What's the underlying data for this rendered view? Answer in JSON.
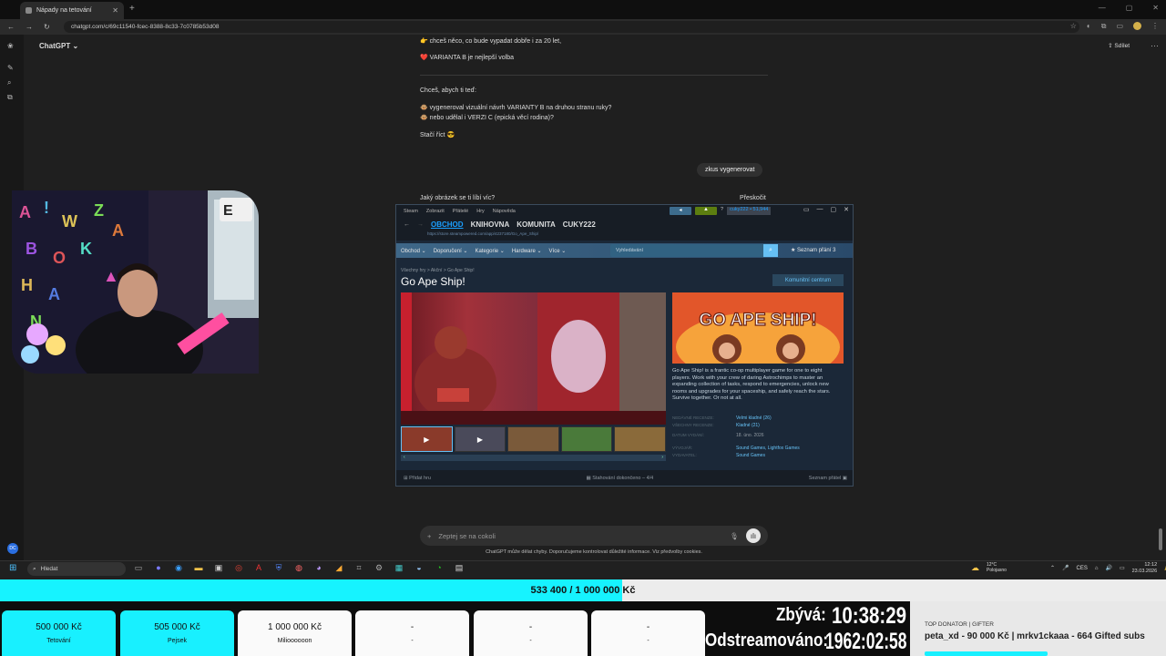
{
  "browser": {
    "tab_title": "Nápady na tetování",
    "url": "chatgpt.com/c/69c11540-fcec-8388-8c33-7c0785b53d08"
  },
  "chatgpt": {
    "app_name": "ChatGPT",
    "share_label": "Sdílet",
    "lines": [
      {
        "icon": "👉",
        "text": "chceš něco, co bude vypadat dobře i za 20 let,"
      },
      {
        "icon": "❤️",
        "text": "VARIANTA B je nejlepší volba"
      }
    ],
    "offer_intro": "Chceš, abych ti teď:",
    "offer_items": [
      {
        "icon": "🐵",
        "text": "vygeneroval vizuální návrh VARIANTY B na druhou stranu ruky?"
      },
      {
        "icon": "🐵",
        "text": "nebo udělal i VERZI C (epická věcí rodina)?"
      }
    ],
    "outro": "Stačí říct 😎",
    "user_message": "zkus vygenerovat",
    "question": "Jaký obrázek se ti líbí víc?",
    "skip": "Přeskočit",
    "prompt_placeholder": "Zeptej se na cokoli",
    "disclaimer": "ChatGPT může dělat chyby. Doporučujeme kontrolovat důležité informace. Viz předvolby cookies."
  },
  "steam": {
    "topmenu": [
      "Steam",
      "Zobrazit",
      "Přátelé",
      "Hry",
      "Nápověda"
    ],
    "username": "cuky222 • 51,944",
    "nav": [
      "OBCHOD",
      "KNIHOVNA",
      "KOMUNITA",
      "CUKY222"
    ],
    "store_url": "https://store.steampowered.com/app/4237180/Go_Ape_Ship/",
    "menu": [
      "Obchod ⌄",
      "Doporučení ⌄",
      "Kategorie ⌄",
      "Hardware ⌄",
      "Více ⌄"
    ],
    "search_placeholder": "Vyhledávání",
    "wishlist": "★ Seznam přání 3",
    "breadcrumb": "Všechny hry > Akční > Go Ape Ship!",
    "game_title": "Go Ape Ship!",
    "community_hub": "Komunitní centrum",
    "capsule_title": "GO APE SHIP!",
    "description": "Go Ape Ship! is a frantic co-op multiplayer game for one to eight players. Work with your crew of daring Astrochimps to master an expanding collection of tasks, respond to emergencies, unlock new rooms and upgrades for your spaceship, and safely reach the stars. Survive together. Or not at all.",
    "info": [
      {
        "k": "Nedávné recenze:",
        "v": "Velmi kladné (26)"
      },
      {
        "k": "Všechny recenze:",
        "v": "Kladné (21)"
      },
      {
        "k": "Datum vydání:",
        "v": "18. úno. 2026"
      },
      {
        "k": "Vývojář:",
        "v": "Sound Games, Lightfox Games"
      },
      {
        "k": "Vydavatel:",
        "v": "Sound Games"
      }
    ],
    "bottom_left": "Přidat hru",
    "bottom_mid": "Stahování dokončeno – 4/4",
    "bottom_right": "Seznam přátel"
  },
  "taskbar": {
    "search": "Hledat",
    "weather_temp": "12°C",
    "weather_desc": "Polojasno",
    "lang": "CES",
    "time": "12:12",
    "date": "23.03.2026"
  },
  "stream": {
    "goal_text": "533 400 / 1 000 000 Kč",
    "goal_progress": 0.5334,
    "cards": [
      {
        "amount": "500 000 Kč",
        "label": "Tetování",
        "filled": true
      },
      {
        "amount": "505 000 Kč",
        "label": "Pejsek",
        "filled": true
      },
      {
        "amount": "1 000 000 Kč",
        "label": "Milioooooon",
        "filled": false
      },
      {
        "amount": "-",
        "label": "-",
        "filled": false
      },
      {
        "amount": "-",
        "label": "-",
        "filled": false
      },
      {
        "amount": "-",
        "label": "-",
        "filled": false
      }
    ],
    "remaining_label": "Zbývá:",
    "remaining_value": "10:38:29",
    "streamed_label": "Odstreamováno:",
    "streamed_value": "1962:02:58",
    "top_donor_header": "Top donator | Gifter",
    "top_donor_value": "peta_xd - 90 000 Kč | mrkv1ckaaa - 664 Gifted subs"
  },
  "colors": {
    "goal_fill": "#16f3ff",
    "steam_bg": "#1b2838",
    "steam_link": "#66c0f4"
  }
}
